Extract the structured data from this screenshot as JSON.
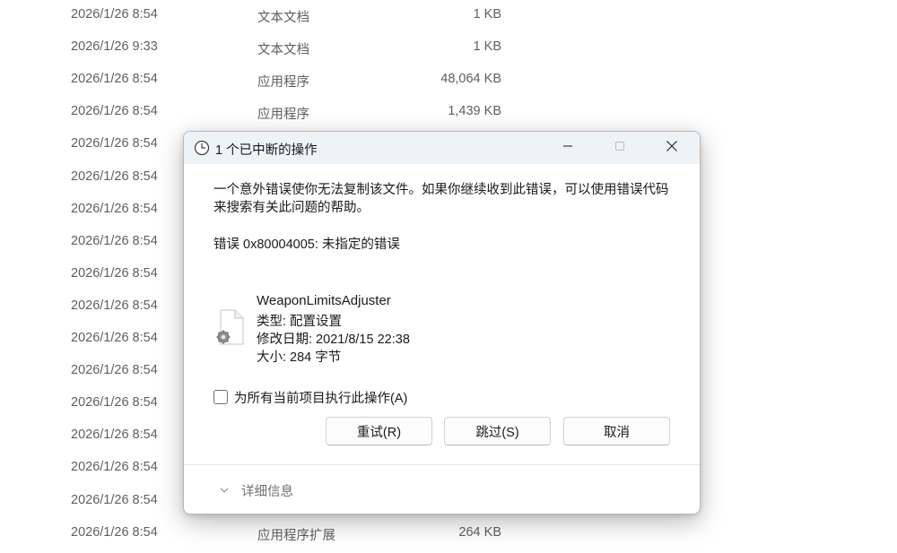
{
  "file_list": {
    "rows": [
      {
        "date": "2026/1/26 8:54",
        "type": "文本文档",
        "size": "1 KB"
      },
      {
        "date": "2026/1/26 9:33",
        "type": "文本文档",
        "size": "1 KB"
      },
      {
        "date": "2026/1/26 8:54",
        "type": "应用程序",
        "size": "48,064 KB"
      },
      {
        "date": "2026/1/26 8:54",
        "type": "应用程序",
        "size": "1,439 KB"
      },
      {
        "date": "2026/1/26 8:54",
        "type": "",
        "size": ""
      },
      {
        "date": "2026/1/26 8:54",
        "type": "",
        "size": ""
      },
      {
        "date": "2026/1/26 8:54",
        "type": "",
        "size": ""
      },
      {
        "date": "2026/1/26 8:54",
        "type": "",
        "size": ""
      },
      {
        "date": "2026/1/26 8:54",
        "type": "",
        "size": ""
      },
      {
        "date": "2026/1/26 8:54",
        "type": "",
        "size": ""
      },
      {
        "date": "2026/1/26 8:54",
        "type": "",
        "size": ""
      },
      {
        "date": "2026/1/26 8:54",
        "type": "",
        "size": ""
      },
      {
        "date": "2026/1/26 8:54",
        "type": "",
        "size": ""
      },
      {
        "date": "2026/1/26 8:54",
        "type": "",
        "size": ""
      },
      {
        "date": "2026/1/26 8:54",
        "type": "",
        "size": ""
      },
      {
        "date": "2026/1/26 8:54",
        "type": "",
        "size": ""
      },
      {
        "date": "2026/1/26 8:54",
        "type": "应用程序扩展",
        "size": "264 KB"
      }
    ]
  },
  "dialog": {
    "title": "1 个已中断的操作",
    "title_icon": "clock-icon",
    "minimize_icon": "minimize-icon",
    "maximize_icon": "maximize-icon",
    "close_icon": "close-icon",
    "message": "一个意外错误使你无法复制该文件。如果你继续收到此错误，可以使用错误代码来搜索有关此问题的帮助。",
    "error_text": "错误 0x80004005: 未指定的错误",
    "file": {
      "icon": "config-file-icon",
      "name": "WeaponLimitsAdjuster",
      "type": "类型: 配置设置",
      "modified": "修改日期: 2021/8/15 22:38",
      "size": "大小: 284 字节"
    },
    "apply_all": {
      "label": "为所有当前项目执行此操作(A)",
      "checked": false
    },
    "buttons": {
      "retry": "重试(R)",
      "skip": "跳过(S)",
      "cancel": "取消"
    },
    "details": {
      "label": "详细信息",
      "icon": "chevron-down-icon"
    }
  },
  "colors": {
    "titlebar_bg": "#eef3f8",
    "list_text": "#5f5f5f",
    "muted_text": "#707070"
  }
}
